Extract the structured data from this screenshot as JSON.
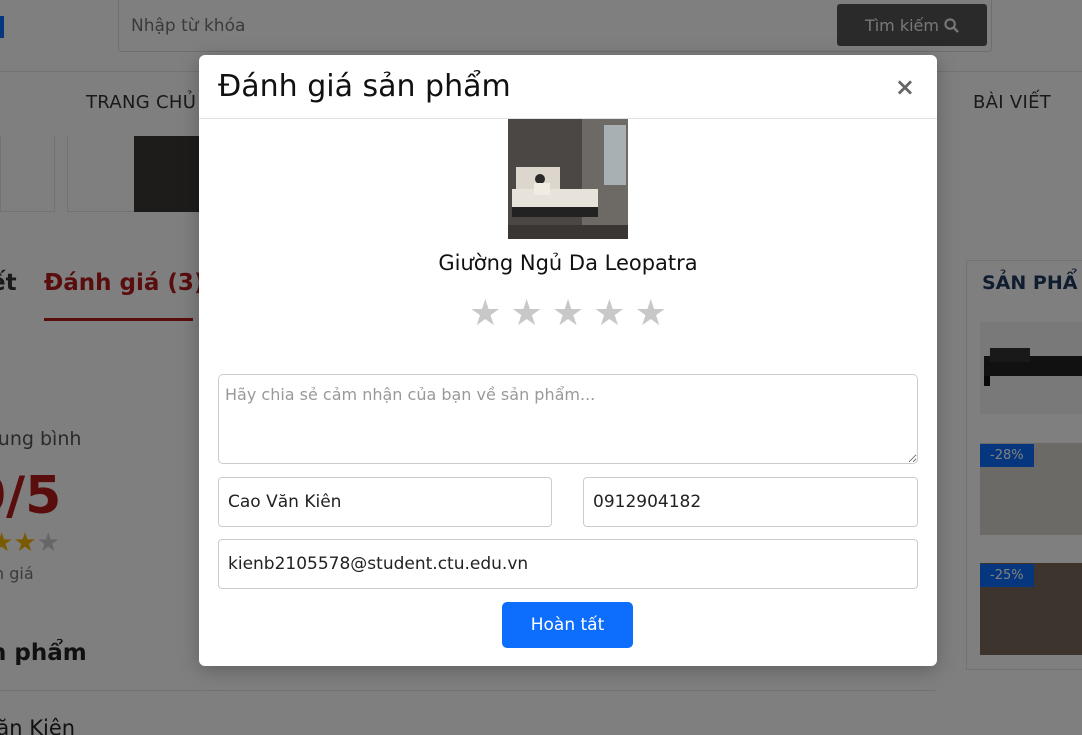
{
  "header": {
    "search_placeholder": "Nhập từ khóa",
    "search_button": "Tìm kiếm"
  },
  "nav": {
    "home": "TRANG CHỦ",
    "articles": "BÀI VIẾT"
  },
  "tabs": {
    "details_partial": "ết",
    "reviews": "Đánh giá (3)"
  },
  "rating_summary": {
    "label_partial": "rung bình",
    "score_partial": "0/5",
    "count_partial": "n giá"
  },
  "reviews_section": {
    "heading_partial": "n phẩm",
    "reviewer_partial": "Văn Kiên"
  },
  "sidebar": {
    "title_partial": "SẢN PHẨ",
    "badges": [
      "-28%",
      "-25%"
    ]
  },
  "modal": {
    "title": "Đánh giá sản phẩm",
    "close_symbol": "×",
    "product_name": "Giường Ngủ Da Leopatra",
    "star_glyph": "★",
    "comment_placeholder": "Hãy chia sẻ cảm nhận của bạn về sản phẩm...",
    "name_value": "Cao Văn Kiên",
    "phone_value": "0912904182",
    "email_value": "kienb2105578@student.ctu.edu.vn",
    "submit_label": "Hoàn tất"
  },
  "colors": {
    "primary": "#0d6efd",
    "accent_red": "#b31b1b",
    "star_empty": "#c8c8c8",
    "star_filled": "#f4b400"
  },
  "icons": {
    "search": "search-icon",
    "close": "close-icon",
    "star": "star-icon"
  }
}
